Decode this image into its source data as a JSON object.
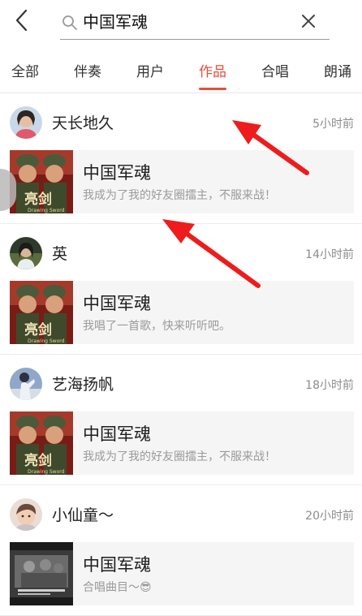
{
  "header": {
    "back_icon": "chevron-left-icon",
    "search": {
      "query": "中国军魂",
      "icon": "search-icon",
      "clear_icon": "close-icon"
    }
  },
  "tabs": [
    {
      "label": "全部",
      "active": false
    },
    {
      "label": "伴奏",
      "active": false
    },
    {
      "label": "用户",
      "active": false
    },
    {
      "label": "作品",
      "active": true
    },
    {
      "label": "合唱",
      "active": false
    },
    {
      "label": "朗诵",
      "active": false
    }
  ],
  "accent_color": "#e84c3d",
  "annotation_color": "#ee1c1c",
  "feed": [
    {
      "user": "天长地久",
      "time": "5小时前",
      "title": "中国军魂",
      "desc": "我成为了我的好友圈擂主，不服来战！",
      "cover": "liangjian"
    },
    {
      "user": "英",
      "time": "14小时前",
      "title": "中国军魂",
      "desc": "我唱了一首歌，快来听听吧。",
      "cover": "liangjian"
    },
    {
      "user": "艺海扬帆",
      "time": "18小时前",
      "title": "中国军魂",
      "desc": "我成为了我的好友圈擂主，不服来战！",
      "cover": "liangjian"
    },
    {
      "user": "小仙童～",
      "time": "20小时前",
      "title": "中国军魂",
      "desc": "合唱曲目～😎",
      "cover": "grayscale-film"
    }
  ]
}
